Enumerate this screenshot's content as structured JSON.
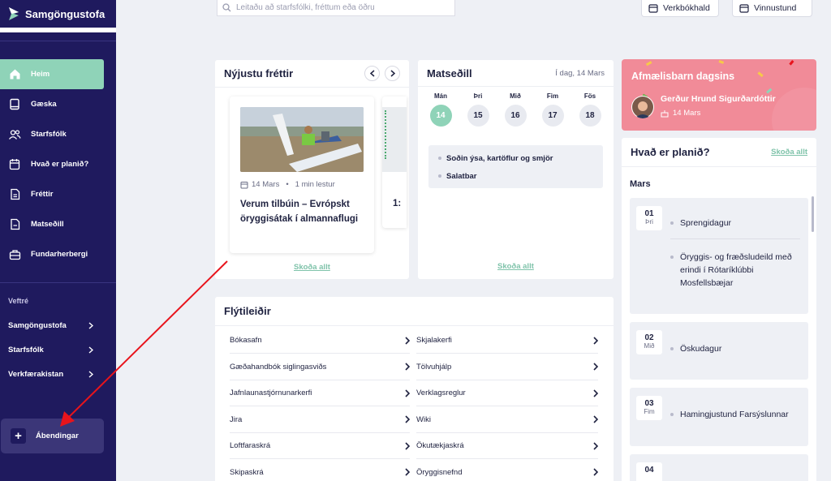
{
  "app": {
    "name": "Samgöngustofa"
  },
  "sidebar": {
    "nav": [
      {
        "label": "Heim",
        "icon": "home-icon",
        "active": true
      },
      {
        "label": "Gæska",
        "icon": "book-icon"
      },
      {
        "label": "Starfsfólk",
        "icon": "people-icon"
      },
      {
        "label": "Hvað er planið?",
        "icon": "calendar-icon"
      },
      {
        "label": "Fréttir",
        "icon": "document-icon"
      },
      {
        "label": "Matseðill",
        "icon": "menu-document-icon"
      },
      {
        "label": "Fundarherbergi",
        "icon": "meeting-room-icon"
      }
    ],
    "section_title": "Veftré",
    "external": [
      {
        "label": "Samgöngustofa"
      },
      {
        "label": "Starfsfólk"
      },
      {
        "label": "Verkfærakistan"
      }
    ],
    "feedback_label": "Ábendingar"
  },
  "topbar": {
    "search_placeholder": "Leitaðu að starfsfólki, fréttum eða öðru",
    "button1": "Verkbókhald",
    "button2": "Vinnustund"
  },
  "news": {
    "title": "Nýjustu fréttir",
    "date": "14 Mars",
    "read_time": "1 min lestur",
    "headline": "Verum tilbúin – Evrópskt öryggisátak í almannaflugi",
    "next_card_partial": "1:",
    "see_all": "Skoða allt"
  },
  "menu": {
    "title": "Matseðill",
    "today": "Í dag, 14 Mars",
    "days": [
      {
        "name": "Mán",
        "num": "14",
        "active": true
      },
      {
        "name": "Þri",
        "num": "15"
      },
      {
        "name": "Mið",
        "num": "16"
      },
      {
        "name": "Fim",
        "num": "17"
      },
      {
        "name": "Fös",
        "num": "18"
      }
    ],
    "items": [
      "Soðin ýsa, kartöflur og smjör",
      "Salatbar"
    ],
    "see_all": "Skoða allt"
  },
  "birthday": {
    "title": "Afmælisbarn dagsins",
    "name": "Gerður Hrund Sigurðardóttir",
    "date": "14 Mars"
  },
  "plan": {
    "title": "Hvað er planið?",
    "see_all": "Skoða allt",
    "month": "Mars",
    "events": [
      {
        "day": "01",
        "weekday": "Þri",
        "items": [
          "Sprengidagur",
          "Öryggis- og fræðsludeild með erindi í Rótaríklúbbi Mosfellsbæjar"
        ]
      },
      {
        "day": "02",
        "weekday": "Mið",
        "items": [
          "Öskudagur"
        ]
      },
      {
        "day": "03",
        "weekday": "Fim",
        "items": [
          "Hamingjustund Farsýslunnar"
        ]
      },
      {
        "day": "04",
        "weekday": "",
        "items": []
      }
    ]
  },
  "quicklinks": {
    "title": "Flýtileiðir",
    "left": [
      "Bókasafn",
      "Gæðahandbók siglingasviðs",
      "Jafnlaunastjórnunarkerfi",
      "Jira",
      "Loftfaraskrá",
      "Skipaskrá"
    ],
    "right": [
      "Skjalakerfi",
      "Tölvuhjálp",
      "Verklagsreglur",
      "Wiki",
      "Ökutækjaskrá",
      "Öryggisnefnd"
    ]
  },
  "colors": {
    "sidebar": "#1f1a5e",
    "accent": "#8fd3b8",
    "birthday": "#f18b98",
    "annotation": "#e8141c"
  }
}
